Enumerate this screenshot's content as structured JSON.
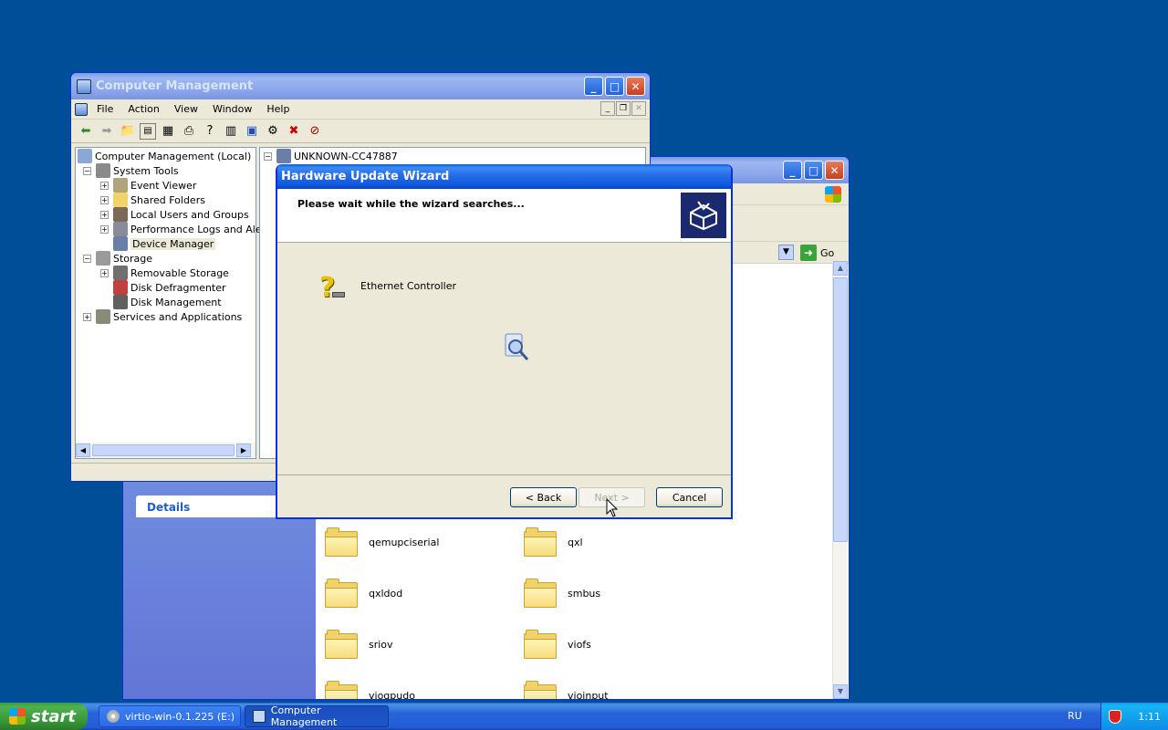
{
  "computer_management": {
    "title": "Computer Management",
    "menu": [
      "File",
      "Action",
      "View",
      "Window",
      "Help"
    ],
    "tree": {
      "root": "Computer Management (Local)",
      "system_tools": "System Tools",
      "event_viewer": "Event Viewer",
      "shared_folders": "Shared Folders",
      "local_users": "Local Users and Groups",
      "perf_logs": "Performance Logs and Alert:",
      "device_manager": "Device Manager",
      "storage": "Storage",
      "removable_storage": "Removable Storage",
      "disk_defrag": "Disk Defragmenter",
      "disk_mgmt": "Disk Management",
      "services_apps": "Services and Applications"
    },
    "right_pane_node": "UNKNOWN-CC47887"
  },
  "explorer": {
    "details_label": "Details",
    "go_label": "Go",
    "folders": [
      "qemupciserial",
      "qxl",
      "qxldod",
      "smbus",
      "sriov",
      "viofs",
      "viogpudo",
      "vioinput"
    ]
  },
  "wizard": {
    "title": "Hardware Update Wizard",
    "heading": "Please wait while the wizard searches...",
    "device": "Ethernet Controller",
    "back_label": "< Back",
    "next_label": "Next >",
    "cancel_label": "Cancel"
  },
  "taskbar": {
    "start_label": "start",
    "tasks": [
      "virtio-win-0.1.225 (E:)",
      "Computer Management"
    ],
    "language": "RU",
    "clock": "1:11"
  },
  "colors": {
    "desktop": "#004e98",
    "titlebar": "#0f58e0",
    "taskbar": "#245edb",
    "start": "#379437"
  }
}
